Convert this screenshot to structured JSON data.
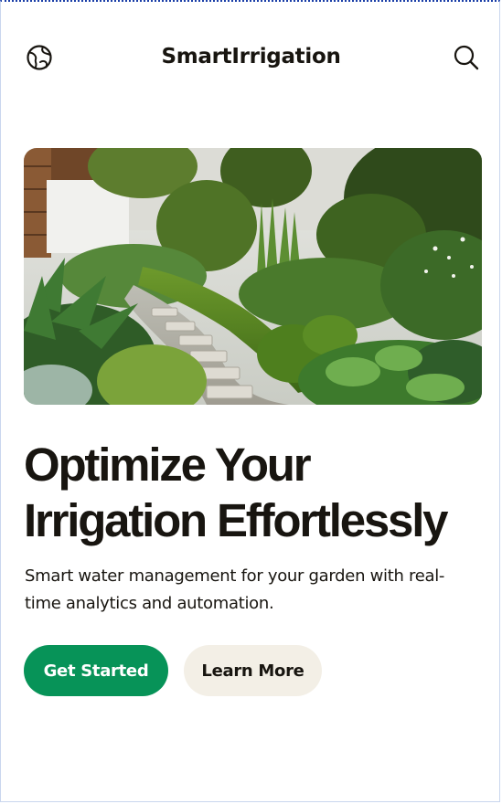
{
  "header": {
    "title": "SmartIrrigation",
    "left_icon": "globe-icon",
    "right_icon": "search-icon"
  },
  "hero": {
    "image": "garden-photo",
    "headline_line1": "Optimize Your",
    "headline_line2": "Irrigation Effortlessly",
    "subtitle_line1": "Smart water management for your garden with real-",
    "subtitle_line2": "time analytics and automation."
  },
  "actions": {
    "primary_label": "Get Started",
    "secondary_label": "Learn More"
  },
  "colors": {
    "primary": "#079358",
    "secondary_bg": "#f3efe6",
    "text": "#181510"
  }
}
